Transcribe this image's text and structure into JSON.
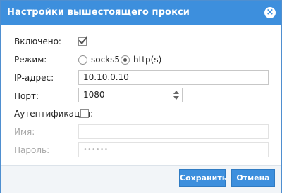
{
  "dialog": {
    "title": "Настройки вышестоящего прокси",
    "close_glyph": "×"
  },
  "form": {
    "enabled": {
      "label": "Включено:",
      "checked": true
    },
    "mode": {
      "label": "Режим:",
      "options": [
        {
          "label": "socks5",
          "selected": false
        },
        {
          "label": "http(s)",
          "selected": true
        }
      ]
    },
    "ip": {
      "label": "IP-адрес:",
      "value": "10.10.0.10"
    },
    "port": {
      "label": "Порт:",
      "value": "1080"
    },
    "auth": {
      "label": "Аутентификация:",
      "checked": false
    },
    "username": {
      "label": "Имя:",
      "value": ""
    },
    "password": {
      "label": "Пароль:",
      "value": "••••••"
    }
  },
  "buttons": {
    "save": "Сохранить",
    "cancel": "Отмена"
  },
  "colors": {
    "accent": "#3d8fdd"
  }
}
